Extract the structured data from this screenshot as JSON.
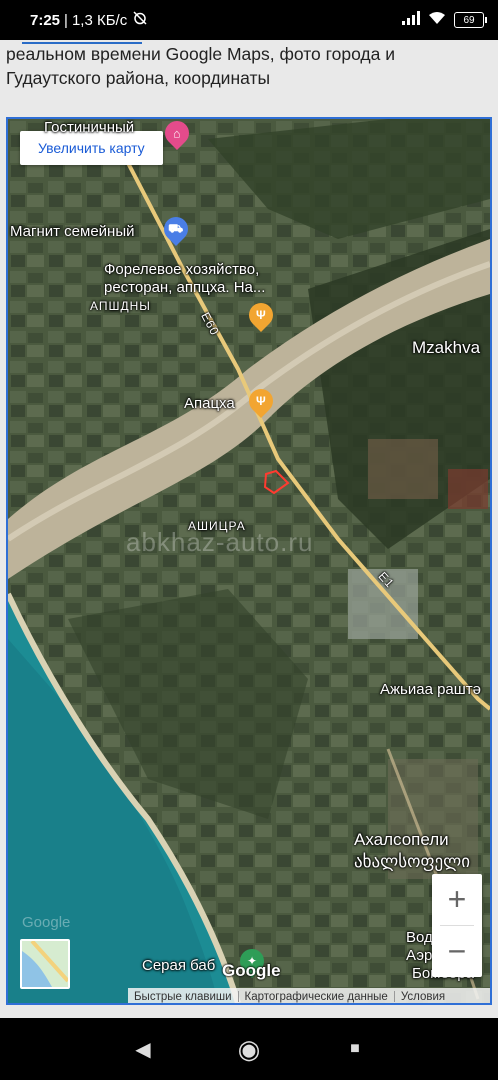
{
  "status_bar": {
    "time": "7:25",
    "speed": "1,3 КБ/с",
    "battery": "69",
    "icons": [
      "alarm-off-icon",
      "signal-icon",
      "wifi-icon",
      "battery-icon"
    ]
  },
  "article": {
    "text": "реальном времени Google Maps, фото города и Гудаутского района, координаты"
  },
  "map": {
    "enlarge_label": "Увеличить карту",
    "labels": {
      "hotel": "Гостиничный",
      "magnit": "Магнит семейный",
      "trout_farm_1": "Форелевое хозяйство,",
      "trout_farm_2": "ресторан, аппцха. На...",
      "apshdny": "АПШДНЫ",
      "road_e60": "E60",
      "mzakhva": "Mzakhva",
      "apatskha": "Апацха",
      "ashitsra": "АШИЦРА",
      "road_e1": "E1",
      "azhyaa": "Ажьиаа раштә",
      "akhalsopeli_ru": "Ахалсопели",
      "akhalsopeli_ka": "ახალსოფელი",
      "voda": "Вод",
      "aero": "Аэр",
      "bombora": "Бомбора",
      "gray": "Серая баб"
    },
    "watermark": "abkhaz-auto.ru",
    "google": "Google",
    "zoom_in": "+",
    "zoom_out": "−",
    "attribution": {
      "shortcuts": "Быстрые клавиши",
      "map_data": "Картографические данные",
      "terms": "Условия"
    },
    "colors": {
      "frame": "#2f6fd6",
      "link": "#1a5bd6",
      "pin_blue": "#4a7ee6",
      "pin_orange": "#f2a531",
      "pin_pink": "#e44b8b",
      "road": "#e8c97a",
      "sea": "#1c8c94"
    }
  },
  "nav_bar": {
    "back": "◀",
    "home": "◉",
    "recents": "■"
  }
}
